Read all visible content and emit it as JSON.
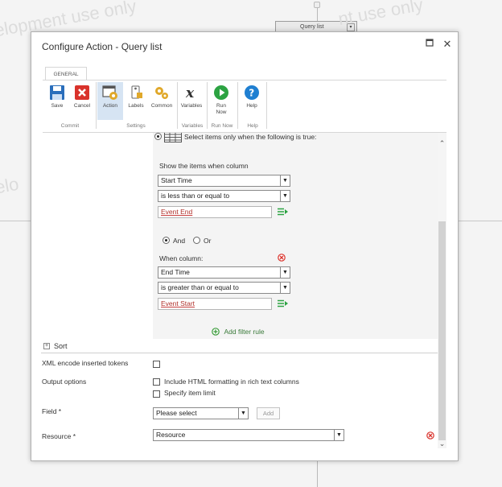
{
  "background": {
    "watermark_texts": [
      "elopment use only",
      "nt use only",
      "elo"
    ],
    "node_label": "Query list"
  },
  "dialog": {
    "title": "Configure Action - Query list",
    "maximize_icon": "maximize-icon",
    "close_icon": "close-icon"
  },
  "ribbon": {
    "tab": "GENERAL",
    "buttons": {
      "save": "Save",
      "cancel": "Cancel",
      "action": "Action",
      "labels": "Labels",
      "common": "Common",
      "variables": "Variables",
      "run_now_1": "Run",
      "run_now_2": "Now",
      "help": "Help"
    },
    "groups": {
      "commit": "Commit",
      "settings": "Settings",
      "variables": "Variables",
      "run_now": "Run Now",
      "help": "Help"
    }
  },
  "filter": {
    "select_items_label": "Select items only when the following is true:",
    "show_items_label": "Show the items when column",
    "condition1": {
      "column": "Start Time",
      "operator": "is less than or equal to",
      "value": "Event End"
    },
    "and_label": "And",
    "or_label": "Or",
    "when_column_label": "When column:",
    "condition2": {
      "column": "End Time",
      "operator": "is greater than or equal to",
      "value": "Event Start"
    },
    "add_filter_rule": "Add filter rule"
  },
  "sort": {
    "label": "Sort"
  },
  "fields": {
    "xml_encode_label": "XML encode inserted tokens",
    "output_options_label": "Output options",
    "include_html_label": "Include HTML formatting in rich text columns",
    "specify_limit_label": "Specify item limit",
    "field_label": "Field *",
    "field_value": "Please select",
    "add_button": "Add",
    "resource_label": "Resource *",
    "resource_value": "Resource"
  },
  "colors": {
    "save_blue": "#2a6ebb",
    "cancel_red": "#d9322b",
    "run_green": "#2ca342",
    "help_blue": "#1f7fd1",
    "token_red": "#b0312b",
    "add_rule_green": "#3a9a3a"
  }
}
